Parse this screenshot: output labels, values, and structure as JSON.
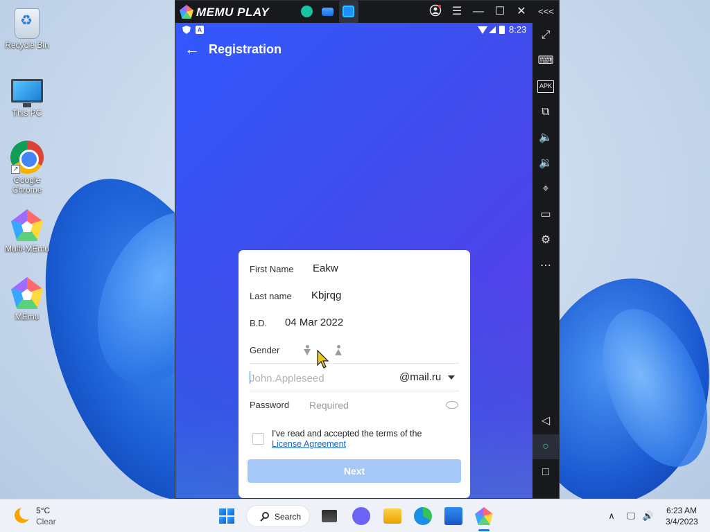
{
  "desktop": {
    "icons": [
      {
        "label": "Recycle Bin"
      },
      {
        "label": "This PC"
      },
      {
        "label": "Google Chrome"
      },
      {
        "label": "Multi-MEmu"
      },
      {
        "label": "MEmu"
      }
    ]
  },
  "emulator": {
    "title": "MEMU PLAY",
    "title_controls": [
      "account-icon",
      "menu-icon",
      "minimize-icon",
      "maximize-icon",
      "close-icon",
      "collapse-sidebar-icon"
    ],
    "side_toolbar": [
      "fullscreen-icon",
      "keyboard-mapping-icon",
      "apk-icon",
      "multi-window-icon",
      "volume-up-icon",
      "volume-down-icon",
      "location-icon",
      "folder-icon",
      "settings-icon",
      "more-icon",
      "android-back-icon",
      "android-home-icon",
      "android-recents-icon"
    ],
    "apk_label": "APK"
  },
  "android": {
    "status_time": "8:23",
    "app_title": "Registration",
    "form": {
      "first_name_label": "First Name",
      "first_name_value": "Eakw",
      "last_name_label": "Last name",
      "last_name_value": "Kbjrqg",
      "bd_label": "B.D.",
      "bd_value": "04 Mar 2022",
      "gender_label": "Gender",
      "email_placeholder": "John.Appleseed",
      "email_domain": "@mail.ru",
      "password_label": "Password",
      "password_placeholder": "Required",
      "terms_text": "I've read and accepted the terms of the",
      "terms_link": "License Agreement",
      "next_label": "Next"
    },
    "colors": {
      "gradient_start": "#3358ff",
      "gradient_end": "#6a3ae6",
      "next_button": "#a6c8f6",
      "link": "#1a66c7"
    }
  },
  "taskbar": {
    "weather_temp": "5°C",
    "weather_desc": "Clear",
    "search_label": "Search",
    "clock_time": "6:23 AM",
    "clock_date": "3/4/2023"
  }
}
